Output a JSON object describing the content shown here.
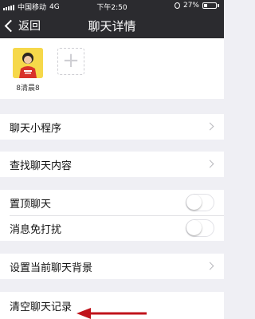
{
  "status_bar": {
    "carrier": "中国移动",
    "network": "4G",
    "time": "下午2:50",
    "battery": "27%"
  },
  "nav": {
    "back_label": "返回",
    "title": "聊天详情"
  },
  "members": {
    "name": "8清晨8",
    "add_symbol": "+"
  },
  "menu": {
    "mini_programs": "聊天小程序",
    "search_history": "查找聊天内容",
    "sticky_on_top": "置顶聊天",
    "mute_notifications": "消息免打扰",
    "set_background": "设置当前聊天背景",
    "clear_history": "清空聊天记录"
  },
  "toggles": {
    "sticky_on_top": false,
    "mute_notifications": false
  },
  "colors": {
    "bar_background": "#2b2b2f",
    "page_background": "#efeff4",
    "arrow": "#c0131b"
  }
}
